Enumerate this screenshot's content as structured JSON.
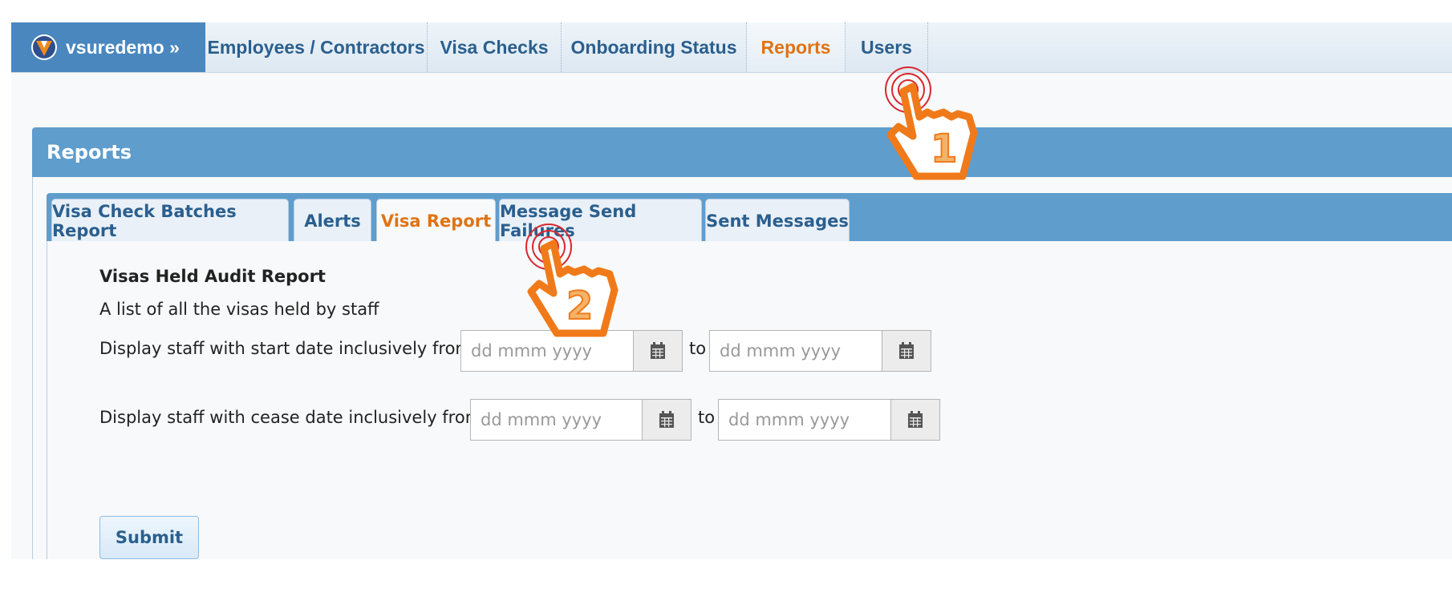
{
  "brand": {
    "name": "vsuredemo »",
    "icon": "vsure-logo-icon"
  },
  "nav": {
    "items": [
      {
        "label": "Employees / Contractors"
      },
      {
        "label": "Visa Checks"
      },
      {
        "label": "Onboarding Status"
      },
      {
        "label": "Reports",
        "active": true
      },
      {
        "label": "Users"
      }
    ]
  },
  "panel": {
    "title": "Reports"
  },
  "tabs": [
    {
      "label": "Visa Check Batches Report"
    },
    {
      "label": "Alerts"
    },
    {
      "label": "Visa Report",
      "active": true
    },
    {
      "label": "Message Send Failures"
    },
    {
      "label": "Sent Messages"
    }
  ],
  "report": {
    "title": "Visas Held Audit Report",
    "description": "A list of all the visas held by staff",
    "start_label": "Display staff with start date inclusively from",
    "cease_label": "Display staff with cease date inclusively from",
    "to_label": "to",
    "date_placeholder": "dd mmm yyyy",
    "submit_label": "Submit"
  },
  "annotations": {
    "step1": "1",
    "step2": "2"
  },
  "colors": {
    "accent": "#e07314",
    "brand": "#4a87bf",
    "panel": "#5f9dcd",
    "link": "#2a5f8e"
  }
}
